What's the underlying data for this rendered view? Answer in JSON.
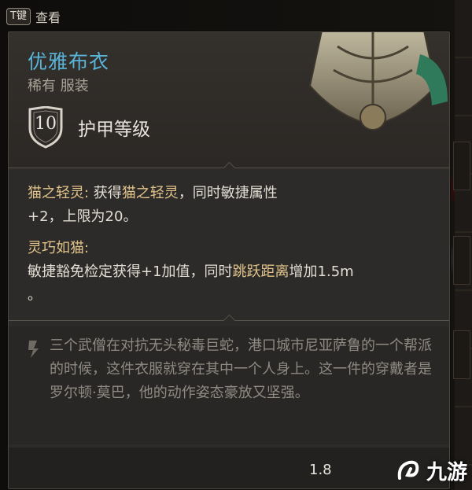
{
  "hotkey": {
    "key": "T键",
    "label": "查看"
  },
  "item": {
    "name": "优雅布衣",
    "rarity_type": "稀有 服装",
    "armor_value": "10",
    "armor_label": "护甲等级"
  },
  "effects": {
    "effect1_title": "猫之轻灵:",
    "effect1_text_a": " 获得",
    "effect1_highlight": "猫之轻灵",
    "effect1_text_b": "，同时敏捷属性",
    "effect1_text_c": "+2，上限为20。",
    "effect2_title": "灵巧如猫:",
    "effect2_text_a": "敏捷豁免检定获得+1加值，同时",
    "effect2_highlight": "跳跃距离",
    "effect2_text_b": "增加1.5m",
    "effect2_text_c": "。"
  },
  "lore": {
    "text": "三个武僧在对抗无头秘毒巨蛇，港口城市尼亚萨鲁的一个帮派的时候，这件衣服就穿在其中一个人身上。这一件的穿戴者是罗尔顿·莫巴，他的动作姿态豪放又坚强。"
  },
  "footer": {
    "weight": "1.8"
  },
  "watermark": {
    "text": "九游"
  },
  "colors": {
    "item_name": "#58b4d8",
    "highlight": "#e2c48a",
    "panel_bg": "#2c2b2a"
  },
  "icons": {
    "shield": "shield-icon",
    "lore": "scroll-icon",
    "watermark": "watermark-logo-icon"
  }
}
